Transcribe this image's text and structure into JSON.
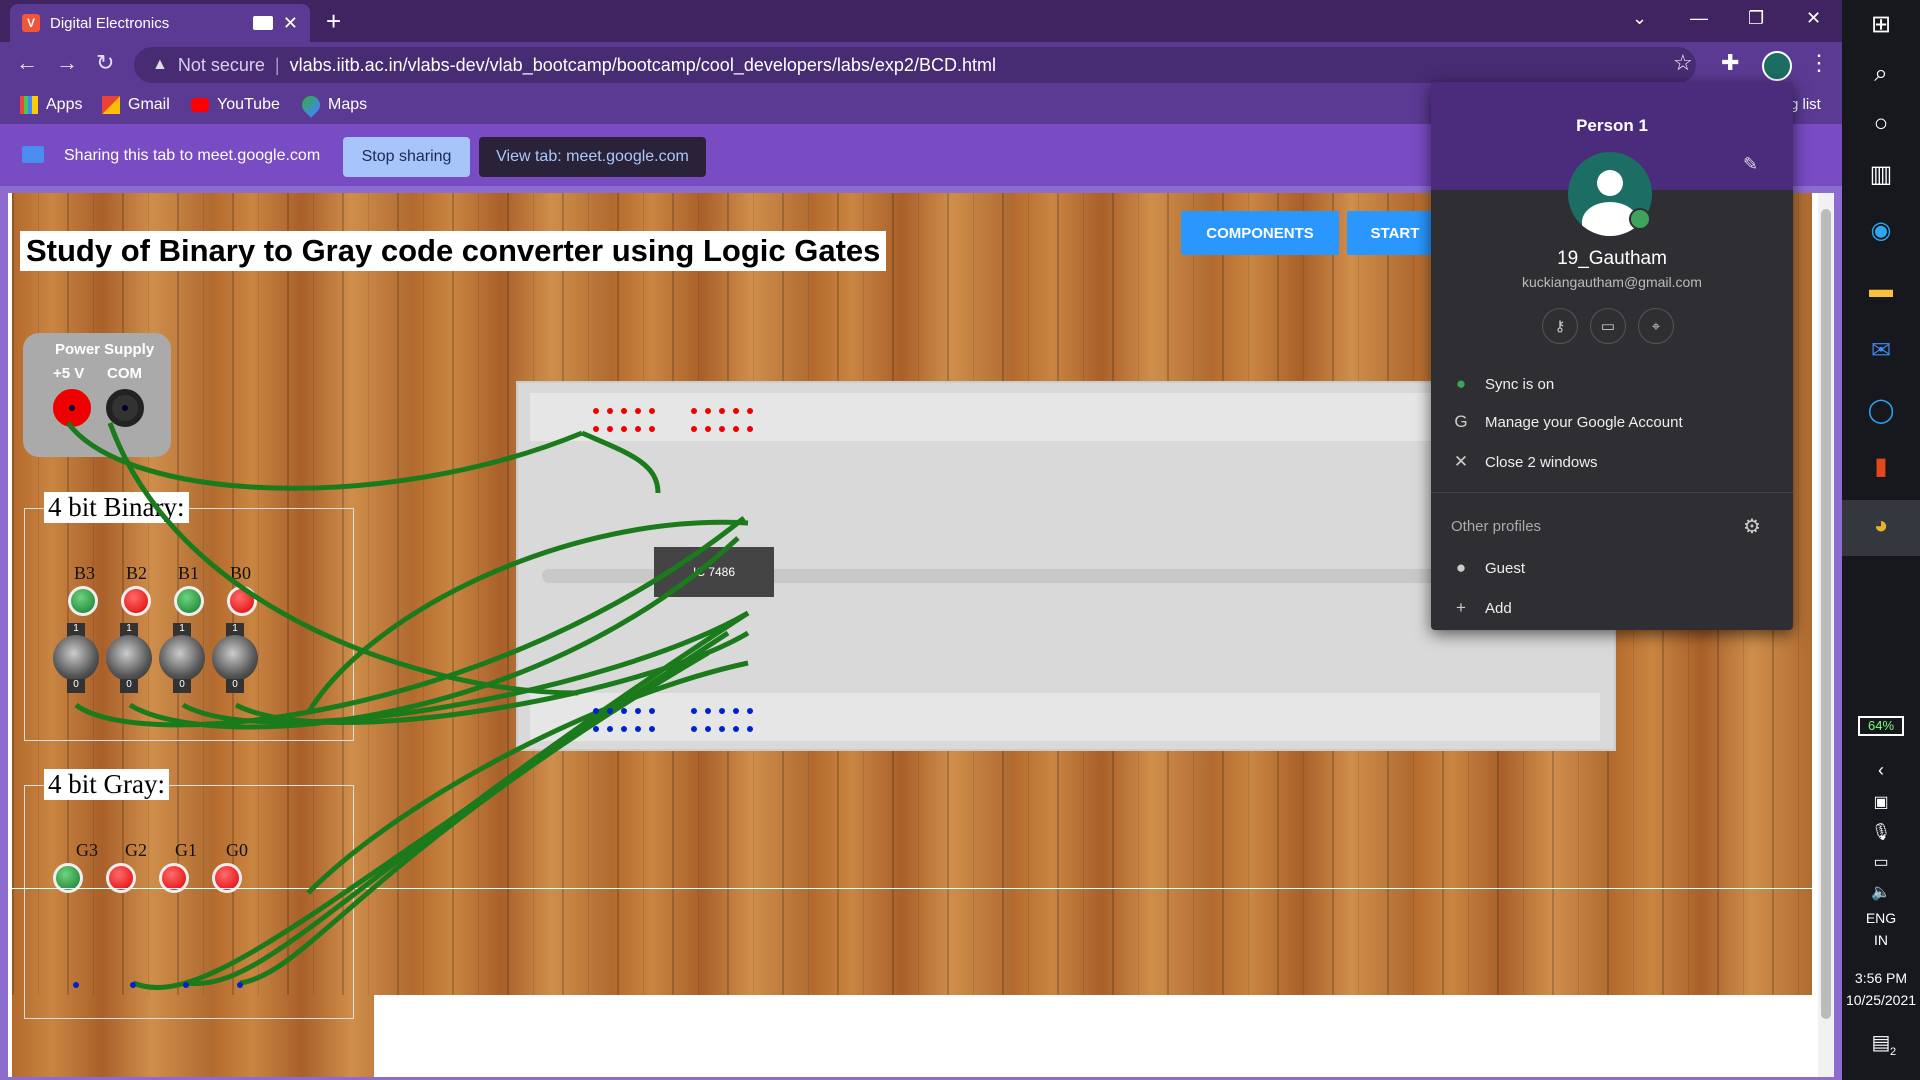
{
  "browser": {
    "tab_title": "Digital Electronics",
    "tab_favicon": "V",
    "url_warning": "Not secure",
    "url": "vlabs.iitb.ac.in/vlabs-dev/vlab_bootcamp/bootcamp/cool_developers/labs/exp2/BCD.html",
    "bookmarks": [
      {
        "label": "Apps",
        "icon": "apps-grid-icon"
      },
      {
        "label": "Gmail",
        "icon": "gmail-icon"
      },
      {
        "label": "YouTube",
        "icon": "youtube-icon"
      },
      {
        "label": "Maps",
        "icon": "maps-icon"
      }
    ],
    "behind_popup_text": "g list"
  },
  "sharing": {
    "text": "Sharing this tab to meet.google.com",
    "stop_label": "Stop sharing",
    "view_label": "View tab: meet.google.com"
  },
  "page": {
    "title": "Study of Binary to Gray code converter using Logic Gates",
    "components_label": "COMPONENTS",
    "start_label": "START",
    "power_supply": {
      "title": "Power Supply",
      "plus": "+5 V",
      "com": "COM"
    },
    "binary_group": {
      "label": "4 bit Binary:",
      "leds": [
        {
          "name": "B3",
          "color": "green"
        },
        {
          "name": "B2",
          "color": "red"
        },
        {
          "name": "B1",
          "color": "green"
        },
        {
          "name": "B0",
          "color": "red"
        }
      ],
      "switch_top": "1",
      "switch_bottom": "0"
    },
    "gray_group": {
      "label": "4 bit Gray:",
      "leds": [
        {
          "name": "G3",
          "color": "green"
        },
        {
          "name": "G2",
          "color": "red"
        },
        {
          "name": "G1",
          "color": "red"
        },
        {
          "name": "G0",
          "color": "red"
        }
      ]
    },
    "ic_label": "IC 7486"
  },
  "profile": {
    "header": "Person 1",
    "user": "19_Gautham",
    "email": "kuckiangautham@gmail.com",
    "sync": "Sync is on",
    "manage": "Manage your Google Account",
    "close_windows": "Close 2 windows",
    "other_profiles": "Other profiles",
    "guest": "Guest",
    "add": "Add"
  },
  "taskbar": {
    "battery": "64%",
    "lang1": "ENG",
    "lang2": "IN",
    "time": "3:56 PM",
    "date": "10/25/2021",
    "notif_count": "2"
  },
  "colors": {
    "accent": "#5b3a94",
    "button_blue": "#2a97ff",
    "wire_green": "#1b7a1b"
  }
}
